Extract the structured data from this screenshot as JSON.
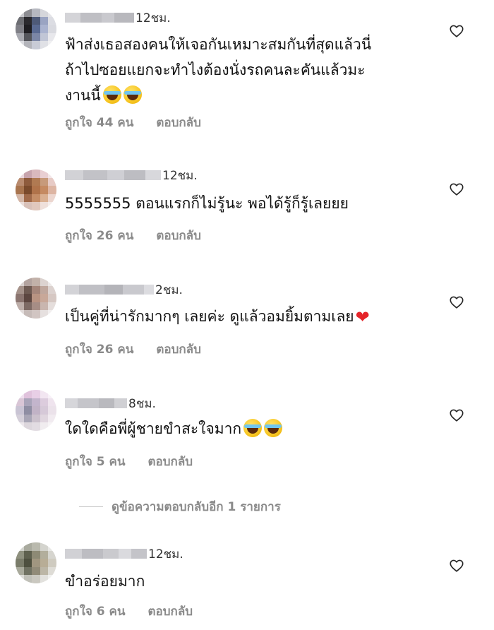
{
  "comments": [
    {
      "time": "12ชม.",
      "lines": [
        "ฟ้าส่งเธอสองคนให้เจอกันเหมาะสมกันที่สุดแล้วนี่",
        "ถ้าไปซอยแยกจะทำไงต้องนั่งรถคนละคันแล้วมะ",
        "งานนี้"
      ],
      "emoji_after_last_line": [
        "face-with-tears-of-joy",
        "face-with-tears-of-joy"
      ],
      "likes": "ถูกใจ 44 คน",
      "reply": "ตอบกลับ"
    },
    {
      "time": "12ชม.",
      "lines": [
        "5555555 ตอนแรกก็ไม่รู้นะ พอได้รู้ก็รู้เลยยย"
      ],
      "likes": "ถูกใจ 26 คน",
      "reply": "ตอบกลับ"
    },
    {
      "time": "2ชม.",
      "lines": [
        "เป็นคู่ที่น่ารักมากๆ เลยค่ะ ดูแล้วอมยิ้มตามเลย"
      ],
      "emoji_after_last_line": [
        "red-heart"
      ],
      "likes": "ถูกใจ 26 คน",
      "reply": "ตอบกลับ"
    },
    {
      "time": "8ชม.",
      "lines": [
        "ใดใดคือพี่ผู้ชายขำสะใจมาก"
      ],
      "emoji_after_last_line": [
        "face-with-tears-of-joy",
        "face-with-tears-of-joy"
      ],
      "likes": "ถูกใจ 5 คน",
      "reply": "ตอบกลับ"
    },
    {
      "time": "12ชม.",
      "lines": [
        "ขำอร่อยมาก"
      ],
      "likes": "ถูกใจ 6 คน",
      "reply": "ตอบกลับ"
    }
  ],
  "more_replies": "ดูข้อความตอบกลับอีก 1 รายการ",
  "colors": {
    "meta_gray": "#8a8a8a",
    "heart_red": "#e5252a"
  },
  "icons": {
    "like": "heart-outline-icon"
  }
}
